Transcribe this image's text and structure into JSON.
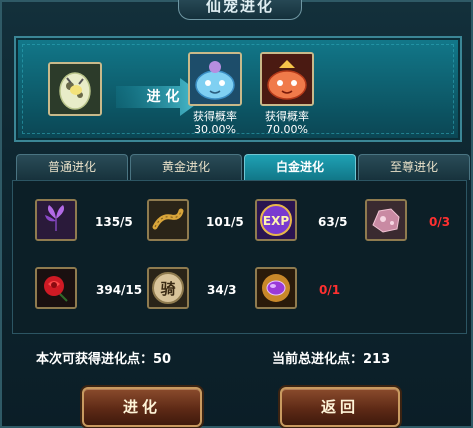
{
  "window": {
    "title": "仙宠进化"
  },
  "preview": {
    "evolve_label": "进 化",
    "results": [
      {
        "label": "获得概率",
        "rate": "30.00%"
      },
      {
        "label": "获得概率",
        "rate": "70.00%"
      }
    ]
  },
  "tabs": [
    {
      "label": "普通进化",
      "active": false
    },
    {
      "label": "黄金进化",
      "active": false
    },
    {
      "label": "白金进化",
      "active": true
    },
    {
      "label": "至尊进化",
      "active": false
    }
  ],
  "materials": [
    {
      "icon": "purple-flower-icon",
      "count": "135/5",
      "sufficient": true
    },
    {
      "icon": "golden-worm-icon",
      "count": "101/5",
      "sufficient": true
    },
    {
      "icon": "exp-orb-icon",
      "icon_text": "EXP",
      "count": "63/5",
      "sufficient": true
    },
    {
      "icon": "pink-ore-icon",
      "count": "0/3",
      "sufficient": false
    },
    {
      "icon": "red-rose-icon",
      "count": "394/15",
      "sufficient": true
    },
    {
      "icon": "ride-token-icon",
      "icon_text": "骑",
      "count": "34/3",
      "sufficient": true
    },
    {
      "icon": "purple-gem-icon",
      "count": "0/1",
      "sufficient": false
    }
  ],
  "points": {
    "gain_label": "本次可获得进化点：",
    "gain_value": "50",
    "total_label": "当前总进化点：",
    "total_value": "213"
  },
  "buttons": {
    "evolve": "进化",
    "back": "返回"
  },
  "colors": {
    "panel": "#0e2630",
    "active_tab": "#1fa1b4",
    "insufficient": "#ff3030",
    "button": "#5e2a16"
  }
}
